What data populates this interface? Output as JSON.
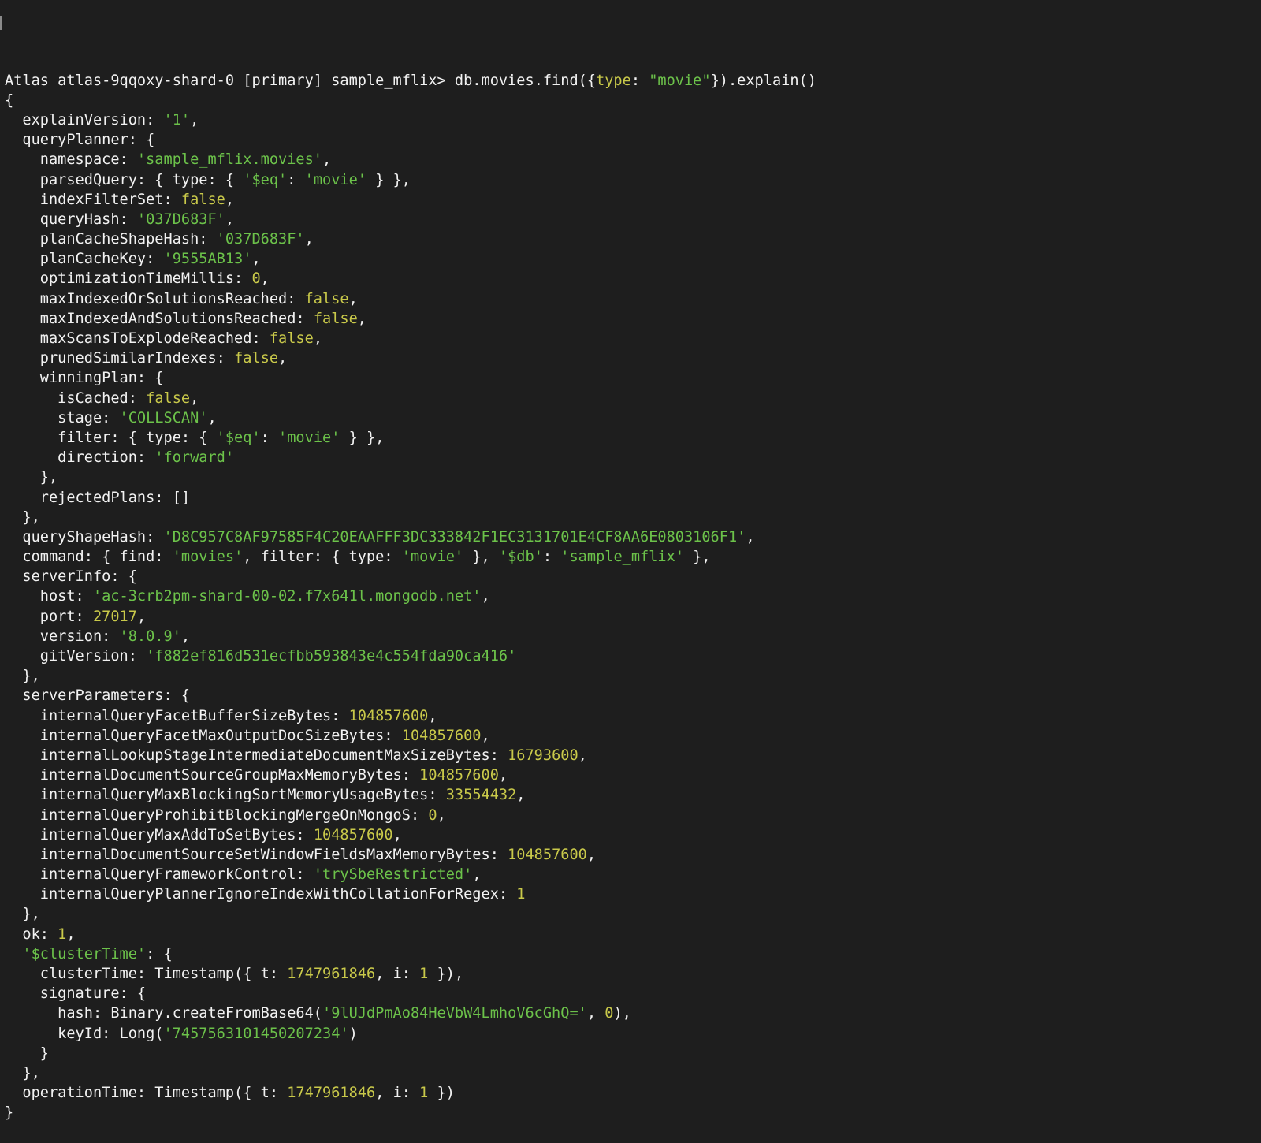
{
  "colors": {
    "background": "#1e1e1e",
    "plain": "#f2f2f2",
    "string": "#6cc24a",
    "number": "#c9c94a"
  },
  "terminal": {
    "lines": [
      [
        [
          "p",
          "Atlas atlas-9qqoxy-shard-0 [primary] sample_mflix> db.movies.find({"
        ],
        [
          "n",
          "type"
        ],
        [
          "p",
          ": "
        ],
        [
          "s",
          "\"movie\""
        ],
        [
          "p",
          "}).explain()"
        ]
      ],
      [
        [
          "p",
          "{"
        ]
      ],
      [
        [
          "p",
          "  explainVersion: "
        ],
        [
          "s",
          "'1'"
        ],
        [
          "p",
          ","
        ]
      ],
      [
        [
          "p",
          "  queryPlanner: {"
        ]
      ],
      [
        [
          "p",
          "    namespace: "
        ],
        [
          "s",
          "'sample_mflix.movies'"
        ],
        [
          "p",
          ","
        ]
      ],
      [
        [
          "p",
          "    parsedQuery: { type: { "
        ],
        [
          "s",
          "'$eq'"
        ],
        [
          "p",
          ": "
        ],
        [
          "s",
          "'movie'"
        ],
        [
          "p",
          " } },"
        ]
      ],
      [
        [
          "p",
          "    indexFilterSet: "
        ],
        [
          "n",
          "false"
        ],
        [
          "p",
          ","
        ]
      ],
      [
        [
          "p",
          "    queryHash: "
        ],
        [
          "s",
          "'037D683F'"
        ],
        [
          "p",
          ","
        ]
      ],
      [
        [
          "p",
          "    planCacheShapeHash: "
        ],
        [
          "s",
          "'037D683F'"
        ],
        [
          "p",
          ","
        ]
      ],
      [
        [
          "p",
          "    planCacheKey: "
        ],
        [
          "s",
          "'9555AB13'"
        ],
        [
          "p",
          ","
        ]
      ],
      [
        [
          "p",
          "    optimizationTimeMillis: "
        ],
        [
          "n",
          "0"
        ],
        [
          "p",
          ","
        ]
      ],
      [
        [
          "p",
          "    maxIndexedOrSolutionsReached: "
        ],
        [
          "n",
          "false"
        ],
        [
          "p",
          ","
        ]
      ],
      [
        [
          "p",
          "    maxIndexedAndSolutionsReached: "
        ],
        [
          "n",
          "false"
        ],
        [
          "p",
          ","
        ]
      ],
      [
        [
          "p",
          "    maxScansToExplodeReached: "
        ],
        [
          "n",
          "false"
        ],
        [
          "p",
          ","
        ]
      ],
      [
        [
          "p",
          "    prunedSimilarIndexes: "
        ],
        [
          "n",
          "false"
        ],
        [
          "p",
          ","
        ]
      ],
      [
        [
          "p",
          "    winningPlan: {"
        ]
      ],
      [
        [
          "p",
          "      isCached: "
        ],
        [
          "n",
          "false"
        ],
        [
          "p",
          ","
        ]
      ],
      [
        [
          "p",
          "      stage: "
        ],
        [
          "s",
          "'COLLSCAN'"
        ],
        [
          "p",
          ","
        ]
      ],
      [
        [
          "p",
          "      filter: { type: { "
        ],
        [
          "s",
          "'$eq'"
        ],
        [
          "p",
          ": "
        ],
        [
          "s",
          "'movie'"
        ],
        [
          "p",
          " } },"
        ]
      ],
      [
        [
          "p",
          "      direction: "
        ],
        [
          "s",
          "'forward'"
        ]
      ],
      [
        [
          "p",
          "    },"
        ]
      ],
      [
        [
          "p",
          "    rejectedPlans: []"
        ]
      ],
      [
        [
          "p",
          "  },"
        ]
      ],
      [
        [
          "p",
          "  queryShapeHash: "
        ],
        [
          "s",
          "'D8C957C8AF97585F4C20EAAFFF3DC333842F1EC3131701E4CF8AA6E0803106F1'"
        ],
        [
          "p",
          ","
        ]
      ],
      [
        [
          "p",
          "  command: { find: "
        ],
        [
          "s",
          "'movies'"
        ],
        [
          "p",
          ", filter: { type: "
        ],
        [
          "s",
          "'movie'"
        ],
        [
          "p",
          " }, "
        ],
        [
          "s",
          "'$db'"
        ],
        [
          "p",
          ": "
        ],
        [
          "s",
          "'sample_mflix'"
        ],
        [
          "p",
          " },"
        ]
      ],
      [
        [
          "p",
          "  serverInfo: {"
        ]
      ],
      [
        [
          "p",
          "    host: "
        ],
        [
          "s",
          "'ac-3crb2pm-shard-00-02.f7x641l.mongodb.net'"
        ],
        [
          "p",
          ","
        ]
      ],
      [
        [
          "p",
          "    port: "
        ],
        [
          "n",
          "27017"
        ],
        [
          "p",
          ","
        ]
      ],
      [
        [
          "p",
          "    version: "
        ],
        [
          "s",
          "'8.0.9'"
        ],
        [
          "p",
          ","
        ]
      ],
      [
        [
          "p",
          "    gitVersion: "
        ],
        [
          "s",
          "'f882ef816d531ecfbb593843e4c554fda90ca416'"
        ]
      ],
      [
        [
          "p",
          "  },"
        ]
      ],
      [
        [
          "p",
          "  serverParameters: {"
        ]
      ],
      [
        [
          "p",
          "    internalQueryFacetBufferSizeBytes: "
        ],
        [
          "n",
          "104857600"
        ],
        [
          "p",
          ","
        ]
      ],
      [
        [
          "p",
          "    internalQueryFacetMaxOutputDocSizeBytes: "
        ],
        [
          "n",
          "104857600"
        ],
        [
          "p",
          ","
        ]
      ],
      [
        [
          "p",
          "    internalLookupStageIntermediateDocumentMaxSizeBytes: "
        ],
        [
          "n",
          "16793600"
        ],
        [
          "p",
          ","
        ]
      ],
      [
        [
          "p",
          "    internalDocumentSourceGroupMaxMemoryBytes: "
        ],
        [
          "n",
          "104857600"
        ],
        [
          "p",
          ","
        ]
      ],
      [
        [
          "p",
          "    internalQueryMaxBlockingSortMemoryUsageBytes: "
        ],
        [
          "n",
          "33554432"
        ],
        [
          "p",
          ","
        ]
      ],
      [
        [
          "p",
          "    internalQueryProhibitBlockingMergeOnMongoS: "
        ],
        [
          "n",
          "0"
        ],
        [
          "p",
          ","
        ]
      ],
      [
        [
          "p",
          "    internalQueryMaxAddToSetBytes: "
        ],
        [
          "n",
          "104857600"
        ],
        [
          "p",
          ","
        ]
      ],
      [
        [
          "p",
          "    internalDocumentSourceSetWindowFieldsMaxMemoryBytes: "
        ],
        [
          "n",
          "104857600"
        ],
        [
          "p",
          ","
        ]
      ],
      [
        [
          "p",
          "    internalQueryFrameworkControl: "
        ],
        [
          "s",
          "'trySbeRestricted'"
        ],
        [
          "p",
          ","
        ]
      ],
      [
        [
          "p",
          "    internalQueryPlannerIgnoreIndexWithCollationForRegex: "
        ],
        [
          "n",
          "1"
        ]
      ],
      [
        [
          "p",
          "  },"
        ]
      ],
      [
        [
          "p",
          "  ok: "
        ],
        [
          "n",
          "1"
        ],
        [
          "p",
          ","
        ]
      ],
      [
        [
          "p",
          "  "
        ],
        [
          "s",
          "'$clusterTime'"
        ],
        [
          "p",
          ": {"
        ]
      ],
      [
        [
          "p",
          "    clusterTime: Timestamp({ t: "
        ],
        [
          "n",
          "1747961846"
        ],
        [
          "p",
          ", i: "
        ],
        [
          "n",
          "1"
        ],
        [
          "p",
          " }),"
        ]
      ],
      [
        [
          "p",
          "    signature: {"
        ]
      ],
      [
        [
          "p",
          "      hash: Binary.createFromBase64("
        ],
        [
          "s",
          "'9lUJdPmAo84HeVbW4LmhoV6cGhQ='"
        ],
        [
          "p",
          ", "
        ],
        [
          "n",
          "0"
        ],
        [
          "p",
          "),"
        ]
      ],
      [
        [
          "p",
          "      keyId: Long("
        ],
        [
          "s",
          "'7457563101450207234'"
        ],
        [
          "p",
          ")"
        ]
      ],
      [
        [
          "p",
          "    }"
        ]
      ],
      [
        [
          "p",
          "  },"
        ]
      ],
      [
        [
          "p",
          "  operationTime: Timestamp({ t: "
        ],
        [
          "n",
          "1747961846"
        ],
        [
          "p",
          ", i: "
        ],
        [
          "n",
          "1"
        ],
        [
          "p",
          " })"
        ]
      ],
      [
        [
          "p",
          "}"
        ]
      ]
    ]
  }
}
